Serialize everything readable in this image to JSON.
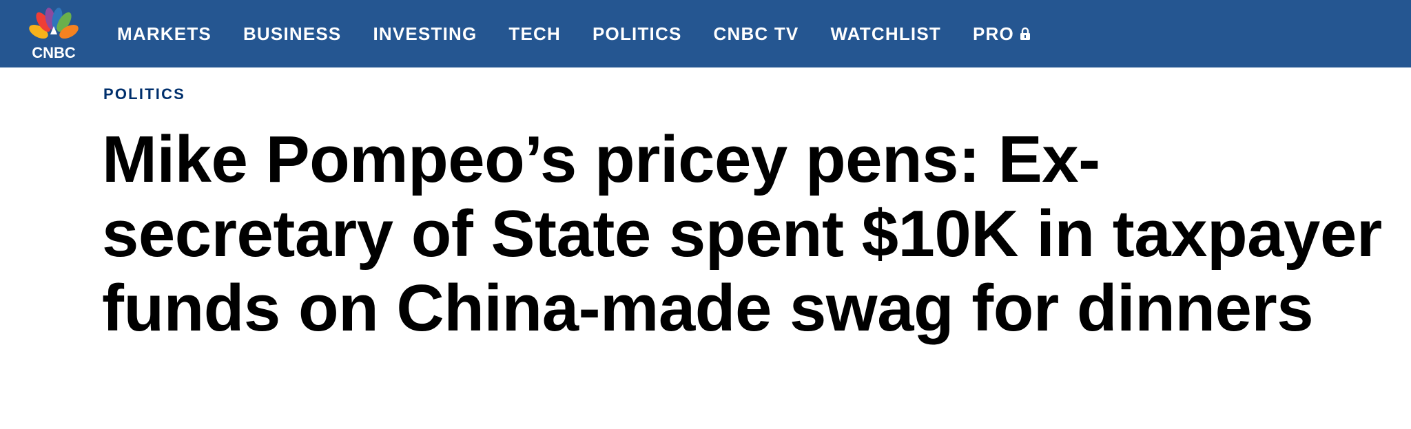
{
  "brand": {
    "logo_text": "CNBC",
    "logo_icon": "peacock-logo-icon",
    "colors": {
      "nav_background": "#255691",
      "section_tag": "#002f6c",
      "headline": "#000000"
    }
  },
  "nav": {
    "items": [
      {
        "label": "MARKETS"
      },
      {
        "label": "BUSINESS"
      },
      {
        "label": "INVESTING"
      },
      {
        "label": "TECH"
      },
      {
        "label": "POLITICS"
      },
      {
        "label": "CNBC TV"
      },
      {
        "label": "WATCHLIST"
      },
      {
        "label": "PRO",
        "icon": "lock-icon"
      }
    ]
  },
  "article": {
    "section": "POLITICS",
    "headline": "Mike Pompeo’s pricey pens: Ex-secretary of State spent $10K in taxpayer funds on China-made swag for dinners"
  }
}
